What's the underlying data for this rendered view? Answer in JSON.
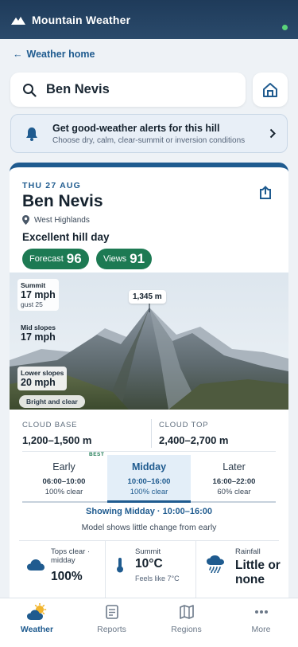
{
  "app": {
    "title": "Mountain Weather"
  },
  "back_link": "Weather home",
  "search": {
    "value": "Ben Nevis"
  },
  "alert_banner": {
    "title": "Get good-weather alerts for this hill",
    "subtitle": "Choose dry, calm, clear-summit or inversion conditions"
  },
  "forecast": {
    "date": "THU 27 AUG",
    "hill": "Ben Nevis",
    "region": "West Highlands",
    "verdict": "Excellent hill day",
    "scores": [
      {
        "label": "Forecast",
        "value": "96"
      },
      {
        "label": "Views",
        "value": "91"
      }
    ],
    "summit_height": "1,345 m",
    "wind": {
      "summit": {
        "label": "Summit",
        "value": "17 mph",
        "gust": "gust 25"
      },
      "mid": {
        "label": "Mid slopes",
        "value": "17 mph"
      },
      "lower": {
        "label": "Lower slopes",
        "value": "20 mph"
      }
    },
    "sky_tag": "Bright and clear",
    "cloud_base": {
      "label": "CLOUD BASE",
      "value": "1,200–1,500 m"
    },
    "cloud_top": {
      "label": "CLOUD TOP",
      "value": "2,400–2,700 m"
    },
    "slots": [
      {
        "name": "Early",
        "time": "06:00–10:00",
        "clear": "100% clear",
        "badge": "BEST"
      },
      {
        "name": "Midday",
        "time": "10:00–16:00",
        "clear": "100% clear"
      },
      {
        "name": "Later",
        "time": "16:00–22:00",
        "clear": "60% clear"
      }
    ],
    "selected_slot": "Midday",
    "showing": "Showing Midday · 10:00–16:00",
    "model_note": "Model shows little change from early",
    "tops": {
      "label": "Tops clear · midday",
      "value": "100%"
    },
    "summit_temp": {
      "label": "Summit",
      "value": "10°C",
      "feels": "Feels like 7°C"
    },
    "rainfall": {
      "label": "Rainfall",
      "value": "Little or none"
    }
  },
  "nav": [
    {
      "label": "Weather",
      "icon": "sun-cloud-icon",
      "active": true
    },
    {
      "label": "Reports",
      "icon": "report-icon"
    },
    {
      "label": "Regions",
      "icon": "map-icon"
    },
    {
      "label": "More",
      "icon": "more-icon"
    }
  ],
  "colors": {
    "brand": "#1f5b8f",
    "score_green": "#1d7a53",
    "topbar": "#1f3b5a"
  }
}
